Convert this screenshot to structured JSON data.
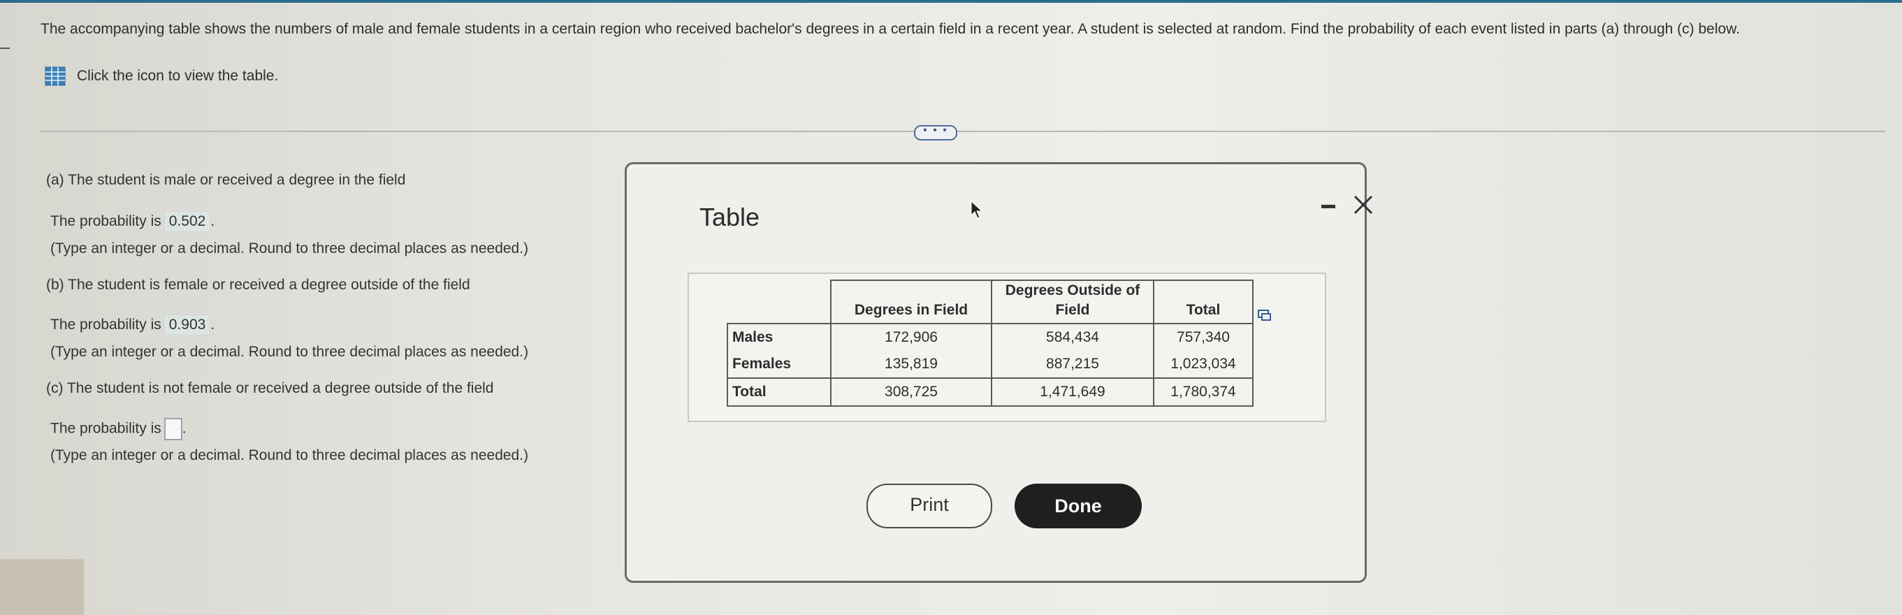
{
  "question": {
    "text": "The accompanying table shows the numbers of male and female students in a certain region who received bachelor's degrees in a certain field in a recent year. A student is selected at random. Find the probability of each event listed in parts (a) through (c) below.",
    "view_table_text": "Click the icon to view the table.",
    "icon": "table-grid-icon"
  },
  "more_button": "• • •",
  "parts": [
    {
      "title": "(a) The student is male or received a degree in the field",
      "prompt": "The probability is",
      "answer": "0.502",
      "hint": "(Type an integer or a decimal. Round to three decimal places as needed.)"
    },
    {
      "title": "(b) The student is female or received a degree outside of the field",
      "prompt": "The probability is",
      "answer": "0.903",
      "hint": "(Type an integer or a decimal. Round to three decimal places as needed.)"
    },
    {
      "title": "(c) The student is not female or received a degree outside of the field",
      "prompt": "The probability is",
      "answer": "",
      "hint": "(Type an integer or a decimal. Round to three decimal places as needed.)"
    }
  ],
  "dialog": {
    "title": "Table",
    "minimize_icon": "minimize-icon",
    "close_icon": "close-icon",
    "print_label": "Print",
    "done_label": "Done"
  },
  "table": {
    "headers": [
      "Degrees in Field",
      "Degrees Outside of Field",
      "Total"
    ],
    "rows": [
      {
        "label": "Males",
        "values": [
          "172,906",
          "584,434",
          "757,340"
        ]
      },
      {
        "label": "Females",
        "values": [
          "135,819",
          "887,215",
          "1,023,034"
        ]
      },
      {
        "label": "Total",
        "values": [
          "308,725",
          "1,471,649",
          "1,780,374"
        ]
      }
    ]
  },
  "colors": {
    "accent": "#2c6c8f",
    "done_button": "#1f1f1f",
    "answer_highlight": "#dde5e3"
  }
}
